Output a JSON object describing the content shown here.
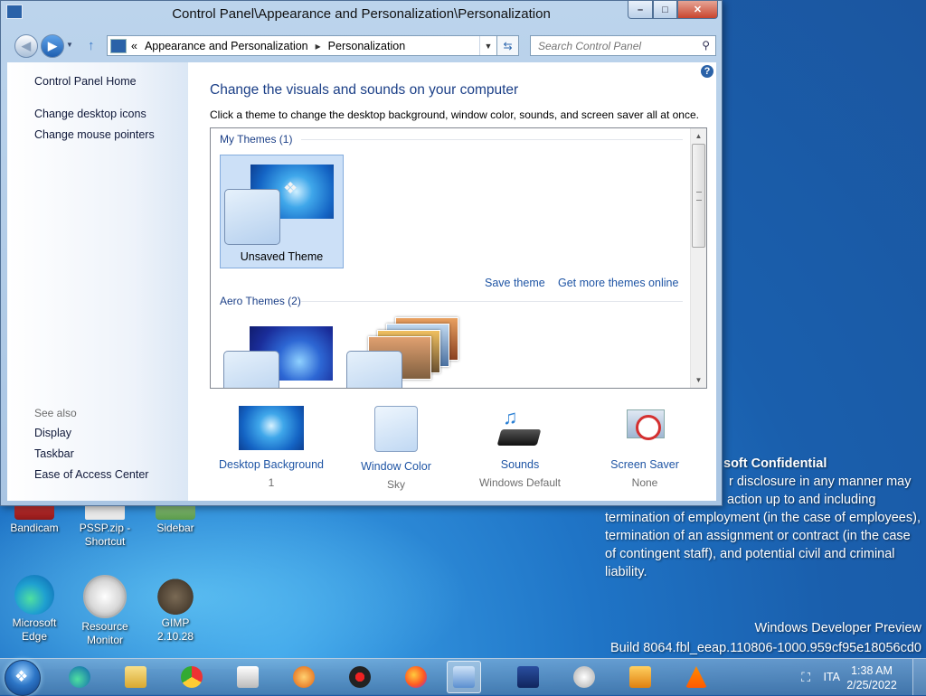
{
  "window": {
    "title": "Control Panel\\Appearance and Personalization\\Personalization",
    "buttons": {
      "minimize": "–",
      "maximize": "□",
      "close": "✕"
    }
  },
  "nav": {
    "back_icon": "◀",
    "forward_icon": "▶",
    "address_prefix": "«",
    "breadcrumb": [
      "Appearance and Personalization",
      "Personalization"
    ],
    "breadcrumb_sep": "▸",
    "search_placeholder": "Search Control Panel"
  },
  "sidebar": {
    "home": "Control Panel Home",
    "links": [
      "Change desktop icons",
      "Change mouse pointers"
    ],
    "see_also_title": "See also",
    "see_also": [
      "Display",
      "Taskbar",
      "Ease of Access Center"
    ]
  },
  "main": {
    "help": "?",
    "heading": "Change the visuals and sounds on your computer",
    "subtext": "Click a theme to change the desktop background, window color, sounds, and screen saver all at once.",
    "my_themes_header": "My Themes (1)",
    "unsaved_theme": "Unsaved Theme",
    "save_theme": "Save theme",
    "get_more": "Get more themes online",
    "aero_header": "Aero Themes (2)"
  },
  "bottom": [
    {
      "title": "Desktop Background",
      "value": "1"
    },
    {
      "title": "Window Color",
      "value": "Sky"
    },
    {
      "title": "Sounds",
      "value": "Windows Default"
    },
    {
      "title": "Screen Saver",
      "value": "None"
    }
  ],
  "desktop_icons": [
    {
      "label": "Bandicam"
    },
    {
      "label": "PSSP.zip - Shortcut"
    },
    {
      "label": "Sidebar"
    },
    {
      "label": "Microsoft Edge"
    },
    {
      "label": "Resource Monitor"
    },
    {
      "label": "GIMP 2.10.28"
    }
  ],
  "confidential": {
    "title": "soft Confidential",
    "line1": "r disclosure in any manner may",
    "line2": "action up to and including",
    "rest": "termination of employment (in the case of employees), termination of an assignment or contract (in the case of contingent staff), and potential civil and criminal liability."
  },
  "watermark": {
    "line1": "Windows Developer Preview",
    "line2": "Build 8064.fbl_eeap.110806-1000.959cf95e18056cd0"
  },
  "taskbar": {
    "language": "ITA",
    "time": "1:38 AM",
    "date": "2/25/2022",
    "apps": [
      "edge",
      "explorer",
      "chrome",
      "321",
      "a-app",
      "obs",
      "firefox",
      "control-panel",
      "monitor",
      "resource-monitor",
      "media",
      "vlc"
    ]
  },
  "colors": {
    "link": "#1e54a4",
    "heading": "#1b3f87",
    "selection": "#cce0f7"
  }
}
